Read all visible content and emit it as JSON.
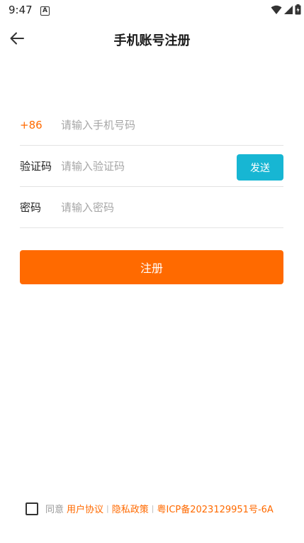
{
  "status_bar": {
    "time": "9:47",
    "notification_icon": "A"
  },
  "header": {
    "title": "手机账号注册"
  },
  "form": {
    "phone": {
      "prefix": "+86",
      "placeholder": "请输入手机号码",
      "value": ""
    },
    "code": {
      "label": "验证码",
      "placeholder": "请输入验证码",
      "value": "",
      "send_label": "发送"
    },
    "password": {
      "label": "密码",
      "placeholder": "请输入密码",
      "value": ""
    }
  },
  "register_label": "注册",
  "agreement": {
    "agree_text": "同意",
    "user_agreement": "用户协议",
    "separator": "|",
    "privacy_policy": "隐私政策",
    "icp": "粤ICP备2023129951号-6A"
  },
  "colors": {
    "accent": "#ff6a00",
    "send_button": "#17b6d3"
  }
}
